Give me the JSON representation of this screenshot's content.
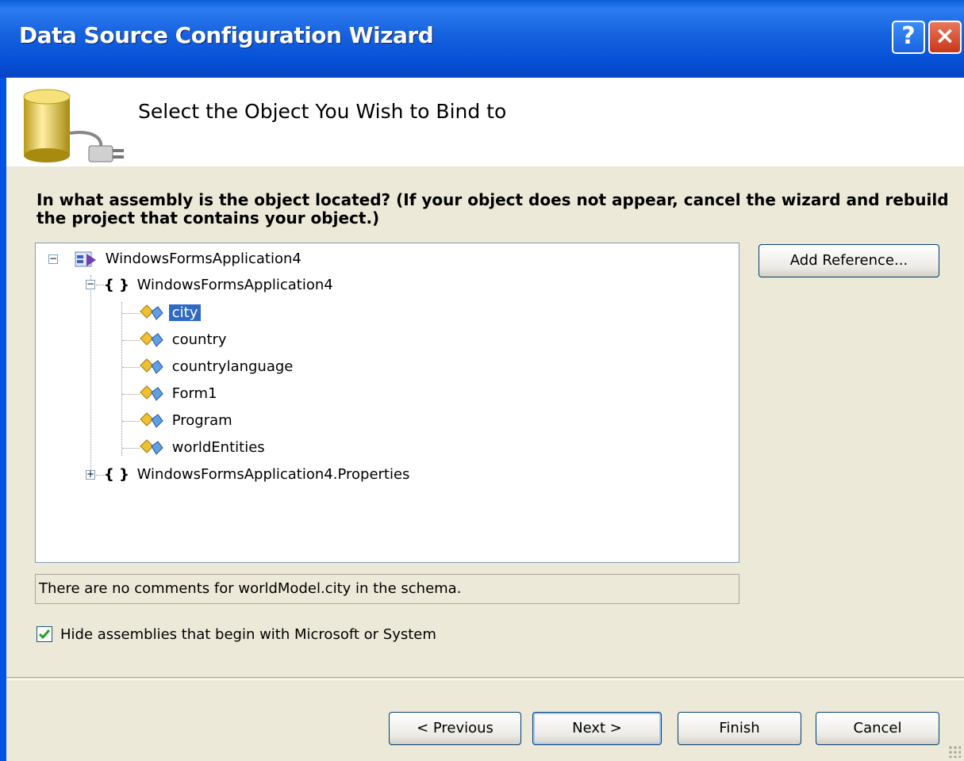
{
  "window": {
    "title": "Data Source Configuration Wizard"
  },
  "titlebar": {
    "help_label": "?",
    "close_label": "×"
  },
  "header": {
    "title": "Select the Object You Wish to Bind to"
  },
  "question": "In what assembly is the object located? (If your object does not appear, cancel the wizard and rebuild the project that contains your object.)",
  "tree": {
    "root": "WindowsFormsApplication4",
    "namespace": "WindowsFormsApplication4",
    "classes": [
      "city",
      "country",
      "countrylanguage",
      "Form1",
      "Program",
      "worldEntities"
    ],
    "selected": "city",
    "namespace2": "WindowsFormsApplication4.Properties",
    "braces": "{ }"
  },
  "add_reference_label": "Add Reference...",
  "comment": "There are no comments for worldModel.city in the schema.",
  "hide_assemblies": {
    "label": "Hide assemblies that begin with Microsoft or System",
    "checked": true
  },
  "buttons": {
    "previous": "< Previous",
    "next": "Next >",
    "finish": "Finish",
    "cancel": "Cancel"
  },
  "colors": {
    "titlebar": "#0054e3",
    "selection": "#316ac5",
    "dialog_bg": "#ece9d8"
  }
}
